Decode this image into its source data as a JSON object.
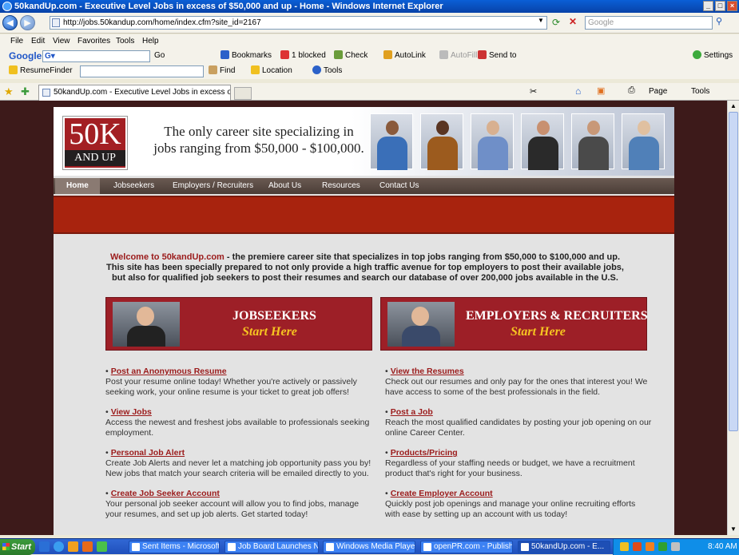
{
  "window": {
    "title": "50kandUp.com - Executive Level Jobs in excess of $50,000 and up - Home - Windows Internet Explorer"
  },
  "address": {
    "url": "http://jobs.50kandup.com/home/index.cfm?site_id=2167",
    "search_placeholder": "Google"
  },
  "menu": [
    "File",
    "Edit",
    "View",
    "Favorites",
    "Tools",
    "Help"
  ],
  "google_toolbar": {
    "brand": "Google",
    "go": "Go",
    "bookmarks": "Bookmarks",
    "blocked": "1 blocked",
    "check": "Check",
    "autolink": "AutoLink",
    "autofill": "AutoFill",
    "sendto": "Send to",
    "settings": "Settings"
  },
  "resume_toolbar": {
    "brand": "ResumeFinder",
    "find": "Find",
    "location": "Location",
    "tools": "Tools"
  },
  "tab": {
    "title": "50kandUp.com - Executive Level Jobs in excess of $5..."
  },
  "command_bar": {
    "page": "Page",
    "tools": "Tools"
  },
  "site": {
    "logo_top": "50K",
    "logo_bottom": "AND UP",
    "tagline_1": "The only career site specializing in",
    "tagline_2": "jobs ranging from $50,000 - $100,000.",
    "nav": [
      "Home",
      "Jobseekers",
      "Employers / Recruiters",
      "About Us",
      "Resources",
      "Contact Us"
    ],
    "welcome_brand": "Welcome to 50kandUp.com",
    "welcome_text": " - the premiere career site that specializes in top jobs ranging from $50,000 to $100,000 and up. This site has been specially prepared to not only provide a high traffic avenue for top employers to post their available jobs, but also for qualified job seekers to post their resumes and search our database of over 200,000 jobs available in the U.S.",
    "promo_jobseekers": {
      "title": "JOBSEEKERS",
      "cta": "Start Here"
    },
    "promo_employers": {
      "title": "EMPLOYERS & RECRUITERS",
      "cta": "Start Here"
    },
    "left_items": [
      {
        "link": "Post an Anonymous Resume",
        "text": "Post your resume online today! Whether you're actively or passively seeking work, your online resume is your ticket to great job offers!"
      },
      {
        "link": "View Jobs",
        "text": "Access the newest and freshest jobs available to professionals seeking employment."
      },
      {
        "link": "Personal Job Alert",
        "text": "Create Job Alerts and never let a matching job opportunity pass you by! New jobs that match your search criteria will be emailed directly to you."
      },
      {
        "link": "Create Job Seeker Account",
        "text": "Your personal job seeker account will allow you to find jobs, manage your resumes, and set up job alerts. Get started today!"
      }
    ],
    "right_items": [
      {
        "link": "View the Resumes",
        "text": "Check out our resumes and only pay for the ones that interest you! We have access to some of the best professionals in the field."
      },
      {
        "link": "Post a Job",
        "text": "Reach the most qualified candidates by posting your job opening on our online Career Center."
      },
      {
        "link": "Products/Pricing",
        "text": "Regardless of your staffing needs or budget, we have a recruitment product that's right for your business."
      },
      {
        "link": "Create Employer Account",
        "text": "Quickly post job openings and manage your online recruiting efforts with ease by setting up an account with us today!"
      }
    ]
  },
  "taskbar": {
    "start": "Start",
    "tasks": [
      "Sent Items - Microsoft ...",
      "Job Board Launches N...",
      "Windows Media Player",
      "openPR.com - Publish ...",
      "50kandUp.com - E..."
    ],
    "clock": "8:40 AM"
  }
}
